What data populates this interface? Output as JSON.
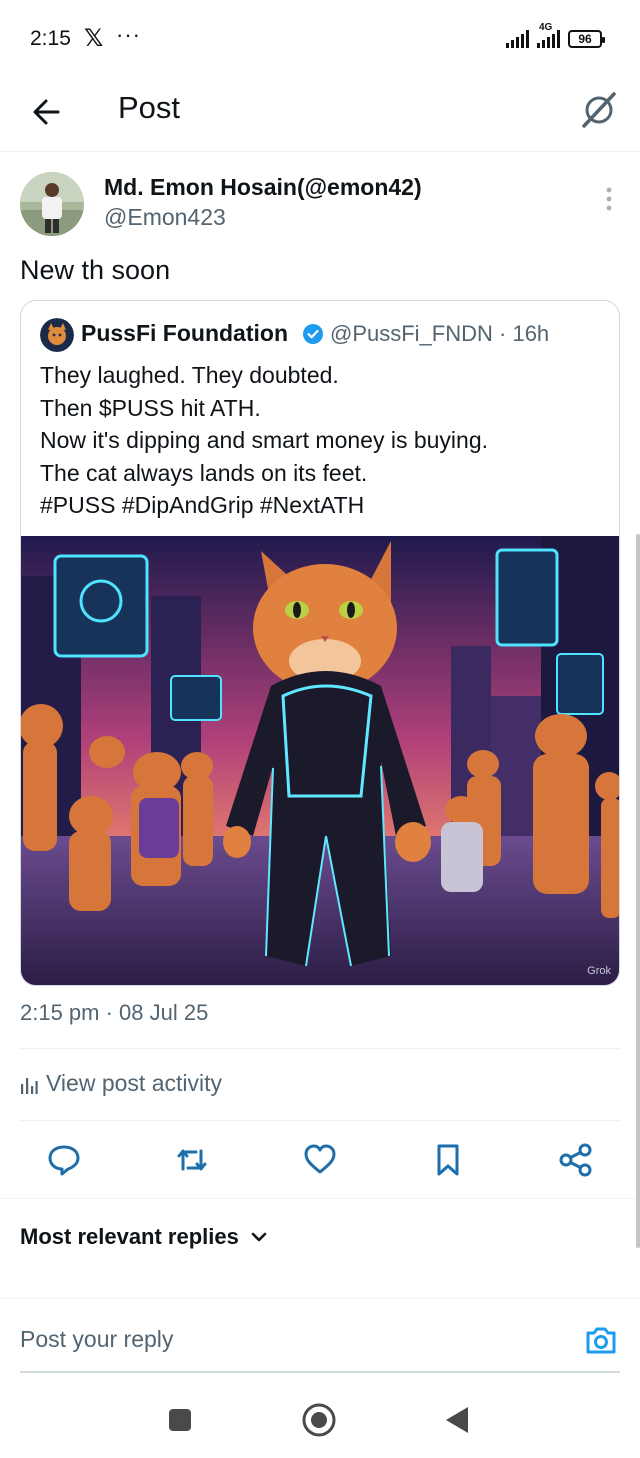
{
  "status_bar": {
    "time": "2:15",
    "app_icon": "x-logo",
    "overflow": "···",
    "network": "4G",
    "battery": "96"
  },
  "header": {
    "back_icon": "arrow-left-icon",
    "title": "Post",
    "grok_icon": "grok-icon"
  },
  "post": {
    "author_name": "Md. Emon Hosain(@emon42)",
    "author_handle": "@Emon423",
    "text": "New th soon",
    "timestamp": "2:15 pm · 08 Jul 25",
    "activity_label": "View post activity"
  },
  "quote": {
    "name": "PussFi Foundation",
    "handle_time": "@PussFi_FNDN · 16h",
    "lines": [
      "They laughed. They doubted.",
      "Then $PUSS hit ATH.",
      "Now it's dipping and smart money is buying.",
      "The cat always lands on its feet.",
      "#PUSS #DipAndGrip #NextATH"
    ],
    "image_badge": "Grok"
  },
  "actions": [
    "reply-icon",
    "repost-icon",
    "like-icon",
    "bookmark-icon",
    "share-icon"
  ],
  "replies": {
    "sort_label": "Most relevant replies",
    "input_placeholder": "Post your reply"
  },
  "colors": {
    "text": "#0f1419",
    "secondary": "#536471",
    "accent": "#1d9bf0",
    "border": "#cfd9de"
  }
}
